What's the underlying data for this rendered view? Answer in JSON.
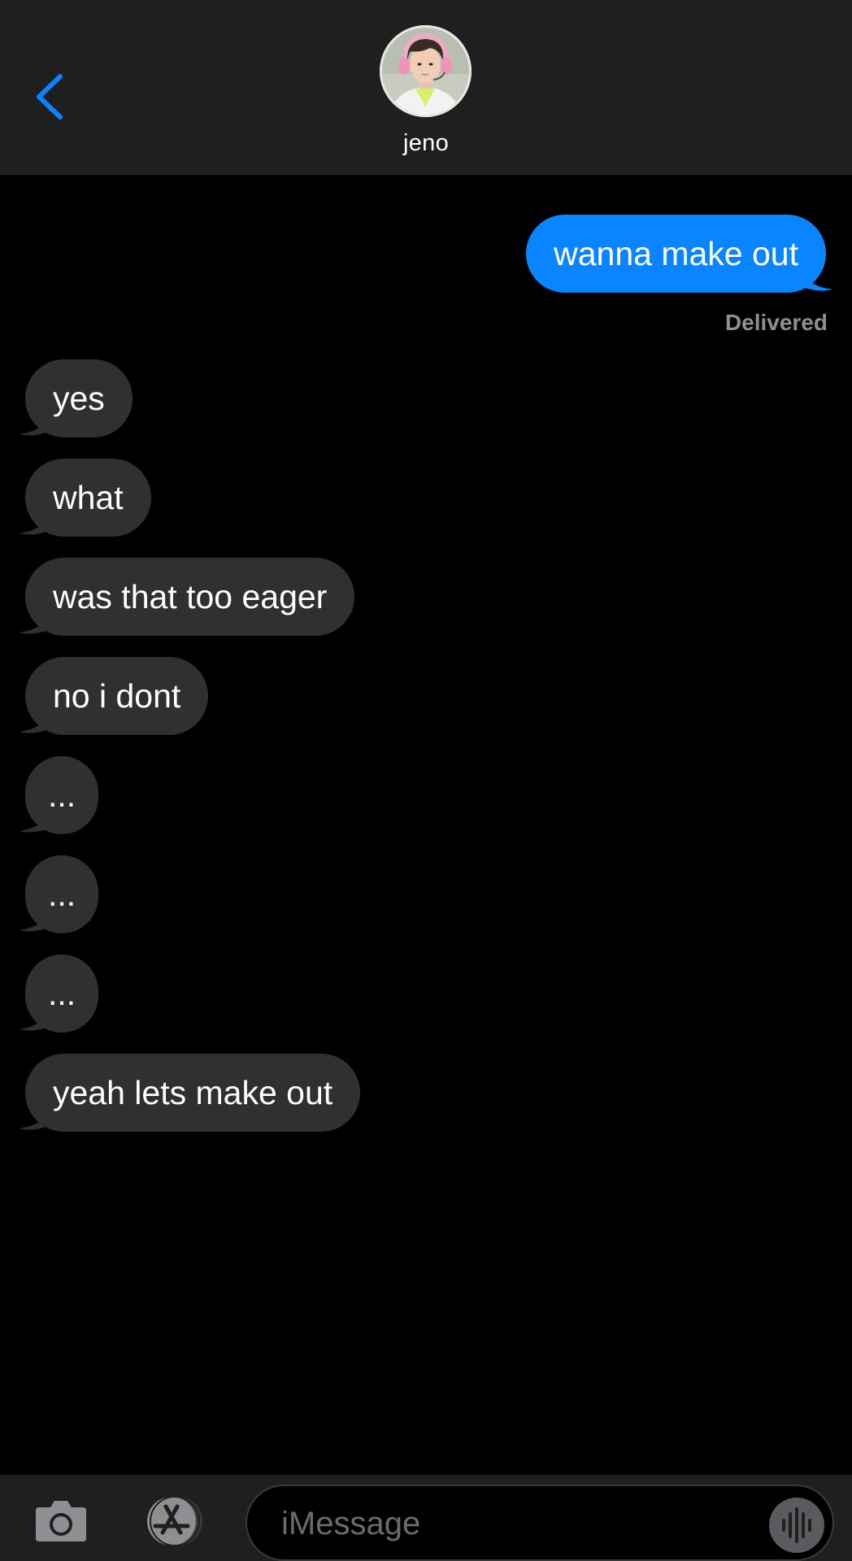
{
  "header": {
    "contact_name": "jeno"
  },
  "messages": [
    {
      "direction": "out",
      "text": "wanna make out"
    },
    {
      "direction": "in",
      "text": "yes"
    },
    {
      "direction": "in",
      "text": "what"
    },
    {
      "direction": "in",
      "text": "was that too eager"
    },
    {
      "direction": "in",
      "text": "no i dont"
    },
    {
      "direction": "in",
      "text": "..."
    },
    {
      "direction": "in",
      "text": "..."
    },
    {
      "direction": "in",
      "text": "..."
    },
    {
      "direction": "in",
      "text": "yeah lets make out"
    }
  ],
  "status": {
    "delivered": "Delivered"
  },
  "input": {
    "placeholder": "iMessage",
    "value": ""
  },
  "icons": {
    "back": "chevron-left-icon",
    "camera": "camera-icon",
    "apps": "app-store-icon",
    "audio": "waveform-icon"
  },
  "colors": {
    "accent": "#0a84ff",
    "incoming_bubble": "#303030",
    "header_bg": "#1f1f1f",
    "status_text": "#8e8e93"
  }
}
